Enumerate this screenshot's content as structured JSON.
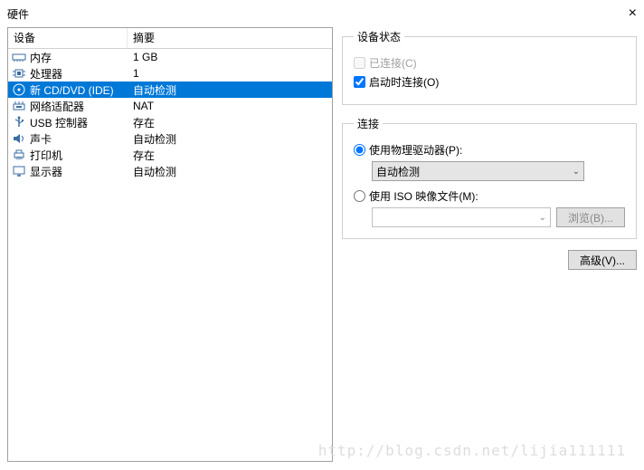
{
  "window": {
    "title": "硬件"
  },
  "table": {
    "col_device": "设备",
    "col_summary": "摘要"
  },
  "devices": [
    {
      "name": "内存",
      "summary": "1 GB",
      "icon": "memory"
    },
    {
      "name": "处理器",
      "summary": "1",
      "icon": "cpu"
    },
    {
      "name": "新 CD/DVD (IDE)",
      "summary": "自动检测",
      "icon": "cd",
      "selected": true
    },
    {
      "name": "网络适配器",
      "summary": "NAT",
      "icon": "network"
    },
    {
      "name": "USB 控制器",
      "summary": "存在",
      "icon": "usb"
    },
    {
      "name": "声卡",
      "summary": "自动检测",
      "icon": "sound"
    },
    {
      "name": "打印机",
      "summary": "存在",
      "icon": "printer"
    },
    {
      "name": "显示器",
      "summary": "自动检测",
      "icon": "display"
    }
  ],
  "status": {
    "legend": "设备状态",
    "connected_label": "已连接(C)",
    "connect_on_start_label": "启动时连接(O)",
    "connected_checked": false,
    "connect_on_start_checked": true
  },
  "connection": {
    "legend": "连接",
    "physical_label": "使用物理驱动器(P):",
    "physical_value": "自动检测",
    "iso_label": "使用 ISO 映像文件(M):",
    "iso_value": "",
    "browse_label": "浏览(B)...",
    "selected": "physical"
  },
  "buttons": {
    "advanced": "高级(V)..."
  },
  "watermark": "http://blog.csdn.net/lijia111111"
}
